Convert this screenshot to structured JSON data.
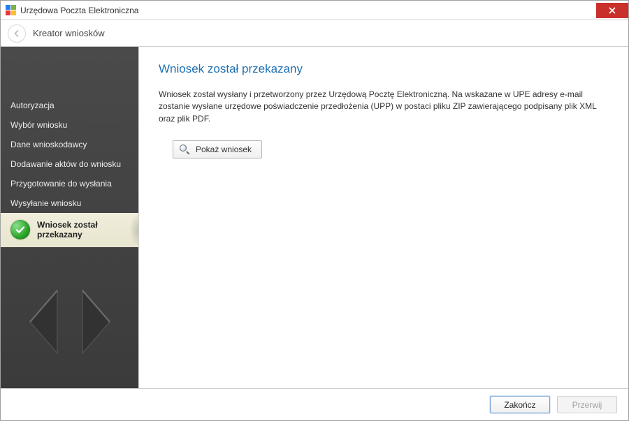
{
  "titlebar": {
    "title": "Urzędowa Poczta Elektroniczna",
    "icon_colors": [
      "#2a7de1",
      "#7cb342",
      "#e53935",
      "#fbc02d"
    ]
  },
  "subheader": {
    "title": "Kreator wniosków"
  },
  "sidebar": {
    "items": [
      {
        "label": "Autoryzacja"
      },
      {
        "label": "Wybór wniosku"
      },
      {
        "label": "Dane wnioskodawcy"
      },
      {
        "label": "Dodawanie aktów do wniosku"
      },
      {
        "label": "Przygotowanie do wysłania"
      },
      {
        "label": "Wysyłanie wniosku"
      }
    ],
    "active": {
      "line1": "Wniosek został",
      "line2": "przekazany"
    }
  },
  "content": {
    "title": "Wniosek został przekazany",
    "description": "Wniosek został wysłany i przetworzony przez Urzędową Pocztę Elektroniczną. Na wskazane w UPE adresy e-mail zostanie wysłane urzędowe poświadczenie przedłożenia (UPP) w postaci pliku ZIP zawierającego podpisany plik XML oraz plik PDF.",
    "show_button": "Pokaż wniosek"
  },
  "footer": {
    "finish": "Zakończ",
    "cancel": "Przerwij"
  }
}
